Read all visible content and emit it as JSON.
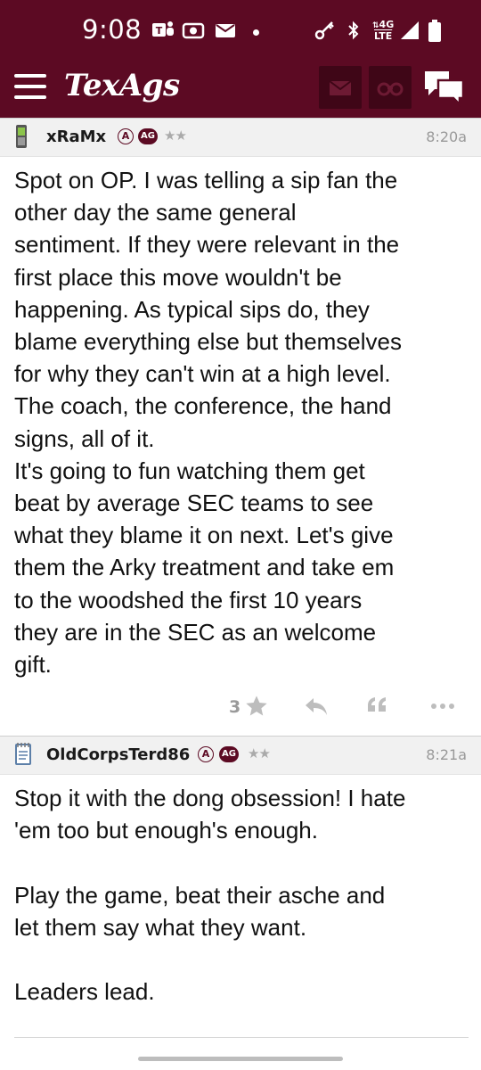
{
  "status_bar": {
    "time": "9:08",
    "network": "4G",
    "network_sub": "LTE",
    "icons": [
      "teams-icon",
      "camera-icon",
      "mail-icon",
      "dot-icon",
      "key-icon",
      "bluetooth-icon",
      "signal-icon",
      "battery-icon"
    ]
  },
  "header": {
    "brand": "TexAgs",
    "buttons": [
      "menu-icon",
      "messages-icon",
      "binoculars-icon",
      "chat-icon"
    ],
    "colors": {
      "maroon": "#5c0a23",
      "button_bg": "#3f0617"
    }
  },
  "posts": [
    {
      "username": "xRaMx",
      "badge_a": "A",
      "badge_ag": "AG",
      "stars": "★★",
      "time": "8:20a",
      "avatar": "phone-icon",
      "body": "Spot on OP. I was telling a sip fan the\nother day the same general\nsentiment. If they were relevant in the\nfirst place this move wouldn't be\nhappening. As typical sips do, they\nblame everything else but themselves\nfor why they can't win at a high level.\nThe coach, the conference, the hand\nsigns, all of it.\nIt's going to fun watching them get\nbeat by average SEC teams to see\nwhat they blame it on next. Let's give\nthem the Arky treatment and take em\nto the woodshed the first 10 years\nthey are in the SEC as an welcome\ngift.",
      "star_count": "3"
    },
    {
      "username": "OldCorpsTerd86",
      "badge_a": "A",
      "badge_ag": "AG",
      "stars": "★★",
      "time": "8:21a",
      "avatar": "notepad-icon",
      "body": "Stop it with the dong obsession! I hate\n'em too but enough's enough.\n\nPlay the game, beat their asche and\nlet them say what they want.\n\nLeaders lead."
    }
  ]
}
